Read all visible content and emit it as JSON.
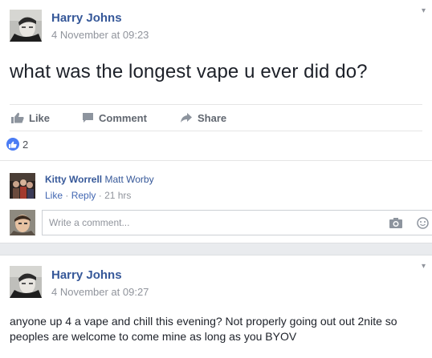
{
  "post1": {
    "author": "Harry Johns",
    "timestamp": "4 November at 09:23",
    "text": "what was the longest vape u ever did do?",
    "actions": {
      "like": "Like",
      "comment": "Comment",
      "share": "Share"
    },
    "like_count": "2",
    "comment": {
      "author": "Kitty Worrell",
      "tagged": "Matt Worby",
      "like": "Like",
      "reply": "Reply",
      "separator": "·",
      "time": "21 hrs"
    },
    "write_comment_placeholder": "Write a comment..."
  },
  "post2": {
    "author": "Harry Johns",
    "timestamp": "4 November at 09:27",
    "text": "anyone up 4 a vape and chill this evening? Not properly going out out 2nite so peoples are welcome to come mine as long as you BYOV"
  },
  "icons": {
    "like": "thumbs-up-icon",
    "comment": "speech-bubble-icon",
    "share": "share-arrow-icon",
    "camera": "camera-icon",
    "emoji": "smiley-icon",
    "menu": "chevron-down-icon"
  },
  "colors": {
    "link_blue": "#365899",
    "meta_gray": "#90949c",
    "action_gray": "#616770",
    "like_badge": "#4a7cf4",
    "background": "#e9ebee"
  }
}
